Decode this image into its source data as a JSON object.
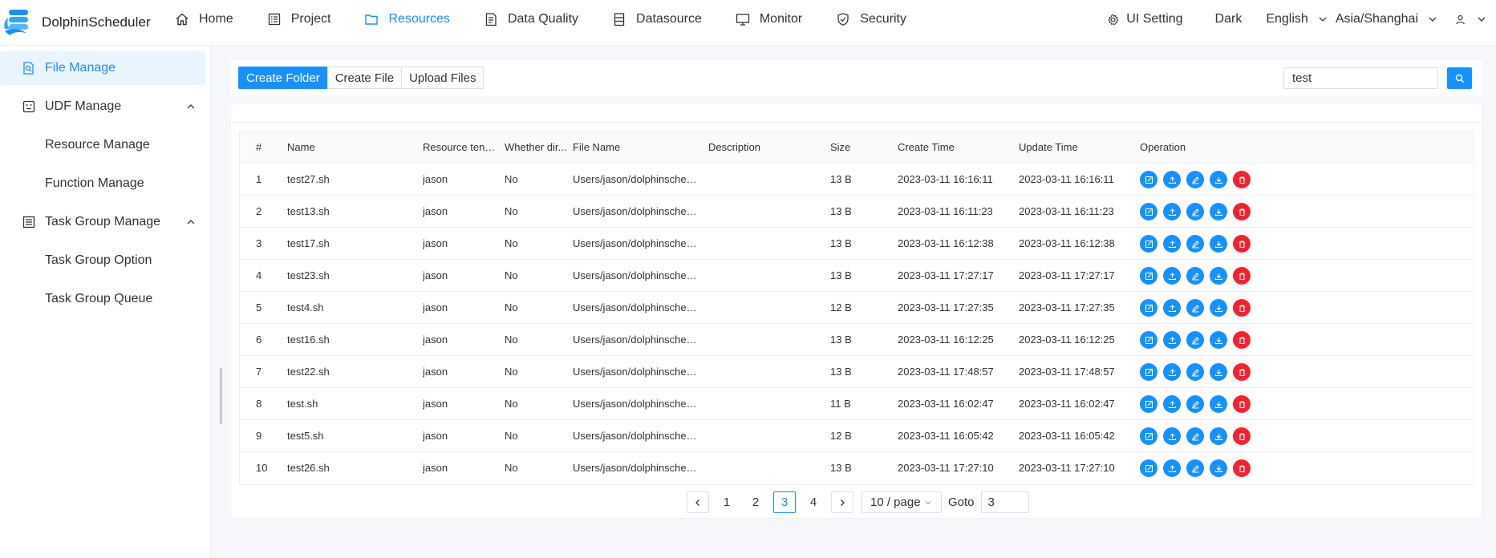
{
  "app": {
    "name": "DolphinScheduler"
  },
  "nav": {
    "items": [
      {
        "label": "Home",
        "icon": "home-icon",
        "active": false
      },
      {
        "label": "Project",
        "icon": "project-icon",
        "active": false
      },
      {
        "label": "Resources",
        "icon": "folder-icon",
        "active": true
      },
      {
        "label": "Data Quality",
        "icon": "data-quality-icon",
        "active": false
      },
      {
        "label": "Datasource",
        "icon": "datasource-icon",
        "active": false
      },
      {
        "label": "Monitor",
        "icon": "monitor-icon",
        "active": false
      },
      {
        "label": "Security",
        "icon": "shield-icon",
        "active": false
      }
    ],
    "ui_setting": "UI Setting",
    "theme": "Dark",
    "language": "English",
    "timezone": "Asia/Shanghai"
  },
  "sidebar": {
    "items": [
      {
        "label": "File Manage",
        "icon": "file-search-icon",
        "active": true,
        "level": 1
      },
      {
        "label": "UDF Manage",
        "icon": "udf-icon",
        "active": false,
        "level": 1,
        "expanded": true
      },
      {
        "label": "Resource Manage",
        "level": 2
      },
      {
        "label": "Function Manage",
        "level": 2
      },
      {
        "label": "Task Group Manage",
        "icon": "task-group-icon",
        "active": false,
        "level": 1,
        "expanded": true
      },
      {
        "label": "Task Group Option",
        "level": 2
      },
      {
        "label": "Task Group Queue",
        "level": 2
      }
    ]
  },
  "toolbar": {
    "create_folder": "Create Folder",
    "create_file": "Create File",
    "upload_files": "Upload Files",
    "search_value": "test"
  },
  "table": {
    "columns": [
      "#",
      "Name",
      "Resource tenant...",
      "Whether dir...",
      "File Name",
      "Description",
      "Size",
      "Create Time",
      "Update Time",
      "Operation"
    ],
    "rows": [
      {
        "idx": "1",
        "name": "test27.sh",
        "tenant": "jason",
        "dir": "No",
        "file": "Users/jason/dolphinscheduler...",
        "desc": "",
        "size": "13 B",
        "created": "2023-03-11 16:16:11",
        "updated": "2023-03-11 16:16:11"
      },
      {
        "idx": "2",
        "name": "test13.sh",
        "tenant": "jason",
        "dir": "No",
        "file": "Users/jason/dolphinscheduler...",
        "desc": "",
        "size": "13 B",
        "created": "2023-03-11 16:11:23",
        "updated": "2023-03-11 16:11:23"
      },
      {
        "idx": "3",
        "name": "test17.sh",
        "tenant": "jason",
        "dir": "No",
        "file": "Users/jason/dolphinscheduler...",
        "desc": "",
        "size": "13 B",
        "created": "2023-03-11 16:12:38",
        "updated": "2023-03-11 16:12:38"
      },
      {
        "idx": "4",
        "name": "test23.sh",
        "tenant": "jason",
        "dir": "No",
        "file": "Users/jason/dolphinscheduler...",
        "desc": "",
        "size": "13 B",
        "created": "2023-03-11 17:27:17",
        "updated": "2023-03-11 17:27:17"
      },
      {
        "idx": "5",
        "name": "test4.sh",
        "tenant": "jason",
        "dir": "No",
        "file": "Users/jason/dolphinscheduler...",
        "desc": "",
        "size": "12 B",
        "created": "2023-03-11 17:27:35",
        "updated": "2023-03-11 17:27:35"
      },
      {
        "idx": "6",
        "name": "test16.sh",
        "tenant": "jason",
        "dir": "No",
        "file": "Users/jason/dolphinscheduler...",
        "desc": "",
        "size": "13 B",
        "created": "2023-03-11 16:12:25",
        "updated": "2023-03-11 16:12:25"
      },
      {
        "idx": "7",
        "name": "test22.sh",
        "tenant": "jason",
        "dir": "No",
        "file": "Users/jason/dolphinscheduler...",
        "desc": "",
        "size": "13 B",
        "created": "2023-03-11 17:48:57",
        "updated": "2023-03-11 17:48:57"
      },
      {
        "idx": "8",
        "name": "test.sh",
        "tenant": "jason",
        "dir": "No",
        "file": "Users/jason/dolphinscheduler...",
        "desc": "",
        "size": "11 B",
        "created": "2023-03-11 16:02:47",
        "updated": "2023-03-11 16:02:47"
      },
      {
        "idx": "9",
        "name": "test5.sh",
        "tenant": "jason",
        "dir": "No",
        "file": "Users/jason/dolphinscheduler...",
        "desc": "",
        "size": "12 B",
        "created": "2023-03-11 16:05:42",
        "updated": "2023-03-11 16:05:42"
      },
      {
        "idx": "10",
        "name": "test26.sh",
        "tenant": "jason",
        "dir": "No",
        "file": "Users/jason/dolphinscheduler...",
        "desc": "",
        "size": "13 B",
        "created": "2023-03-11 17:27:10",
        "updated": "2023-03-11 17:27:10"
      }
    ],
    "operations": [
      {
        "icon": "edit-icon",
        "name": "edit-button",
        "color": "#1890ff"
      },
      {
        "icon": "upload-icon",
        "name": "reupload-button",
        "color": "#1890ff"
      },
      {
        "icon": "rename-icon",
        "name": "rename-button",
        "color": "#1890ff"
      },
      {
        "icon": "download-icon",
        "name": "download-button",
        "color": "#1890ff"
      },
      {
        "icon": "delete-icon",
        "name": "delete-button",
        "color": "#f5222d"
      }
    ]
  },
  "pagination": {
    "pages": [
      "1",
      "2",
      "3",
      "4"
    ],
    "current": "3",
    "page_size": "10 / page",
    "goto_label": "Goto",
    "goto_value": "3"
  },
  "colors": {
    "accent": "#1890ff",
    "danger": "#f5222d",
    "active_bg": "#eaf4ff"
  }
}
